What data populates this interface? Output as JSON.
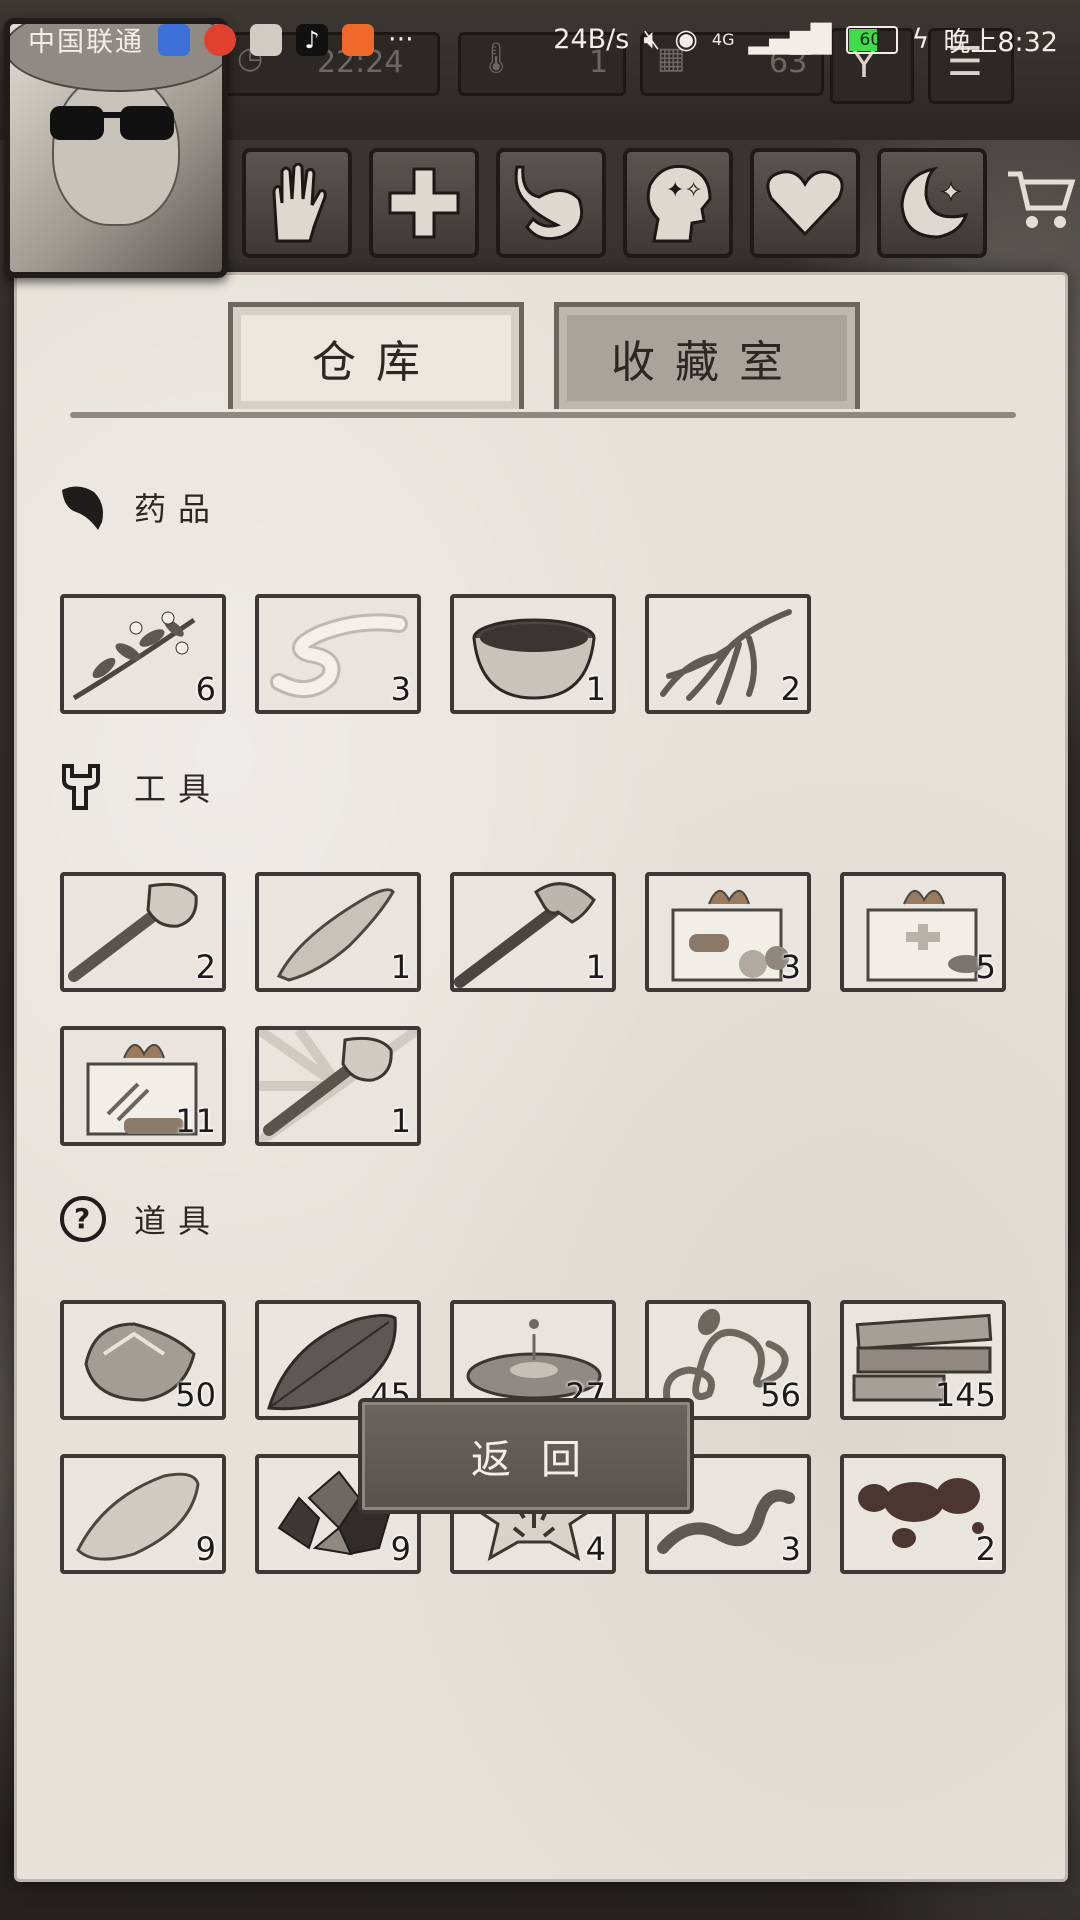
{
  "status_bar": {
    "carrier": "中国联通",
    "speed": "24B/s",
    "network": "4G",
    "battery": "60",
    "time": "晚上8:32",
    "more": "···"
  },
  "hud": {
    "clock": "22:24",
    "day": "1",
    "calendar_value": "63"
  },
  "tabs": [
    {
      "label": "仓库",
      "active": true
    },
    {
      "label": "收藏室",
      "active": false
    }
  ],
  "sections": {
    "medicine": {
      "title": "药品",
      "items": [
        {
          "name": "herb-branch",
          "count": "6"
        },
        {
          "name": "bandage",
          "count": "3"
        },
        {
          "name": "bowl",
          "count": "1"
        },
        {
          "name": "ginseng-root",
          "count": "2"
        }
      ]
    },
    "tools": {
      "title": "工具",
      "items": [
        {
          "name": "stone-hammer",
          "count": "2"
        },
        {
          "name": "stone-blade",
          "count": "1"
        },
        {
          "name": "stone-axe",
          "count": "1"
        },
        {
          "name": "food-gift-box",
          "count": "3"
        },
        {
          "name": "medical-gift-box",
          "count": "5"
        },
        {
          "name": "tool-gift-box",
          "count": "11"
        },
        {
          "name": "special-stone-hammer",
          "count": "1"
        }
      ]
    },
    "props": {
      "title": "道具",
      "items": [
        {
          "name": "stone",
          "count": "50"
        },
        {
          "name": "leaf",
          "count": "45"
        },
        {
          "name": "water-puddle",
          "count": "27"
        },
        {
          "name": "vine",
          "count": "56"
        },
        {
          "name": "wooden-planks",
          "count": "145"
        },
        {
          "name": "flint",
          "count": "9"
        },
        {
          "name": "ore",
          "count": "9"
        },
        {
          "name": "animal-hide",
          "count": "4"
        },
        {
          "name": "worm",
          "count": "3"
        },
        {
          "name": "blood",
          "count": "2"
        }
      ]
    }
  },
  "return_button": "返回",
  "colors": {
    "paper": "#e6e2da",
    "frame": "#3b3835",
    "button": "#5f5954"
  }
}
